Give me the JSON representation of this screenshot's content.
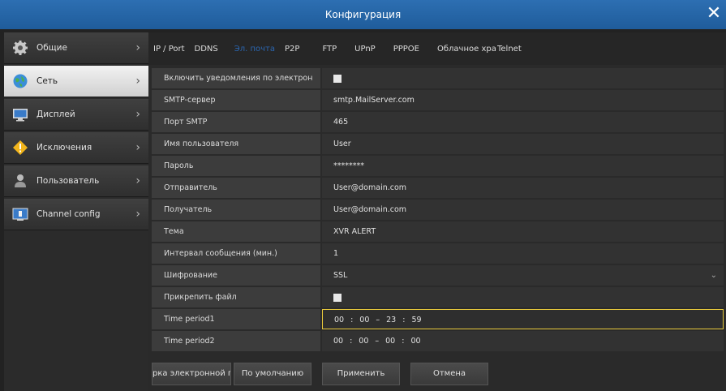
{
  "window": {
    "title": "Конфигурация",
    "close_icon": "✕"
  },
  "sidebar": {
    "items": [
      {
        "label": "Общие",
        "icon": "gear-icon"
      },
      {
        "label": "Сеть",
        "icon": "globe-icon",
        "active": true
      },
      {
        "label": "Дисплей",
        "icon": "monitor-icon"
      },
      {
        "label": "Исключения",
        "icon": "warning-icon"
      },
      {
        "label": "Пользователь",
        "icon": "user-icon"
      },
      {
        "label": "Channel config",
        "icon": "channel-icon"
      }
    ],
    "chevron": "›"
  },
  "tabs": [
    {
      "label": "IP / Port"
    },
    {
      "label": "DDNS"
    },
    {
      "label": "Эл. почта",
      "active": true
    },
    {
      "label": "P2P"
    },
    {
      "label": "FTP"
    },
    {
      "label": "UPnP"
    },
    {
      "label": "PPPOE"
    },
    {
      "label": "Облачное хра"
    },
    {
      "label": "Telnet"
    }
  ],
  "form": {
    "enable_label": "Включить уведомления по электрон",
    "smtp_label": "SMTP-сервер",
    "smtp_value": "smtp.MailServer.com",
    "port_label": "Порт SMTP",
    "port_value": "465",
    "user_label": "Имя пользователя",
    "user_value": "User",
    "pass_label": "Пароль",
    "pass_value": "********",
    "sender_label": "Отправитель",
    "sender_value": "User@domain.com",
    "recipient_label": "Получатель",
    "recipient_value": "User@domain.com",
    "subject_label": "Тема",
    "subject_value": "XVR ALERT",
    "interval_label": "Интервал сообщения (мин.)",
    "interval_value": "1",
    "encryption_label": "Шифрование",
    "encryption_value": "SSL",
    "attach_label": "Прикрепить файл",
    "tp1_label": "Time period1",
    "tp1_h1": "00",
    "tp1_m1": "00",
    "tp1_h2": "23",
    "tp1_m2": "59",
    "tp2_label": "Time period2",
    "tp2_h1": "00",
    "tp2_m1": "00",
    "tp2_h2": "00",
    "tp2_m2": "00",
    "colon": ":",
    "dash": "–"
  },
  "buttons": {
    "test": "рка электронной п",
    "default": "По умолчанию",
    "apply": "Применить",
    "cancel": "Отмена"
  }
}
